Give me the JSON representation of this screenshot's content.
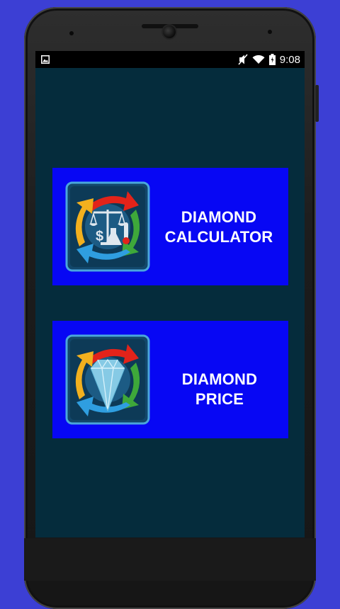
{
  "status_bar": {
    "time": "9:08",
    "icons": [
      "image-icon",
      "mute-icon",
      "wifi-icon",
      "battery-icon"
    ]
  },
  "menu": {
    "items": [
      {
        "id": "calculator",
        "line1": "DIAMOND",
        "line2": "CALCULATOR",
        "icon": "calculator-tools-icon"
      },
      {
        "id": "price",
        "line1": "DIAMOND PRICE",
        "icon": "diamond-icon"
      }
    ]
  },
  "colors": {
    "background": "#3c3fd4",
    "screen": "#052c3c",
    "card": "#0707f4",
    "arrow_red": "#e2231a",
    "arrow_green": "#3ea83a",
    "arrow_blue": "#2f9ee0",
    "arrow_yellow": "#f2b01e"
  }
}
